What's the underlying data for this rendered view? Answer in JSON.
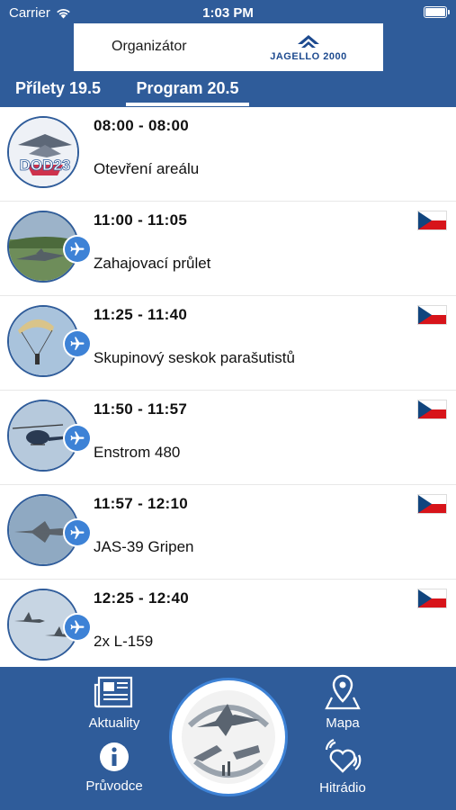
{
  "status_bar": {
    "carrier": "Carrier",
    "time": "1:03 PM"
  },
  "organizer": {
    "label": "Organizátor",
    "sponsor": "JAGELLO 2000"
  },
  "tabs": [
    {
      "label": "Přílety 19.5",
      "active": false
    },
    {
      "label": "Program 20.5",
      "active": true
    }
  ],
  "program": [
    {
      "time": "08:00 - 08:00",
      "title": "Otevření areálu",
      "flag": false,
      "plane_icon": false,
      "thumb_text": "DOD23"
    },
    {
      "time": "11:00 - 11:05",
      "title": "Zahajovací průlet",
      "flag": true,
      "plane_icon": true
    },
    {
      "time": "11:25 - 11:40",
      "title": "Skupinový seskok parašutistů",
      "flag": true,
      "plane_icon": true
    },
    {
      "time": "11:50 - 11:57",
      "title": "Enstrom 480",
      "flag": true,
      "plane_icon": true
    },
    {
      "time": "11:57 - 12:10",
      "title": "JAS-39 Gripen",
      "flag": true,
      "plane_icon": true
    },
    {
      "time": "12:25 - 12:40",
      "title": "2x L-159",
      "flag": true,
      "plane_icon": true
    }
  ],
  "nav": {
    "news": "Aktuality",
    "guide": "Průvodce",
    "map": "Mapa",
    "radio": "Hitrádio"
  },
  "colors": {
    "brand_blue": "#2f5c9a",
    "accent_blue": "#3d82d6"
  }
}
